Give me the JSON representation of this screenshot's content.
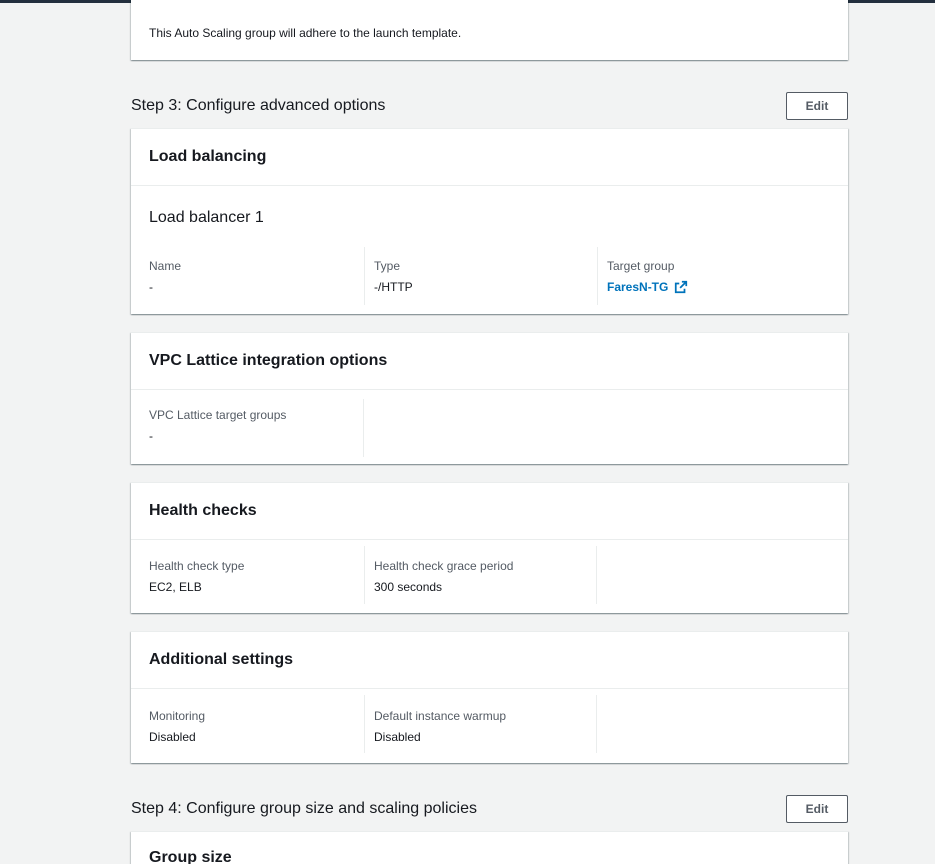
{
  "step2_tail": {
    "text": "This Auto Scaling group will adhere to the launch template."
  },
  "step3": {
    "title": "Step 3: Configure advanced options",
    "edit_label": "Edit"
  },
  "load_balancing": {
    "title": "Load balancing",
    "subtitle": "Load balancer 1",
    "fields": [
      {
        "label": "Name",
        "value": "-"
      },
      {
        "label": "Type",
        "value": "-/HTTP"
      },
      {
        "label": "Target group",
        "value": "FaresN-TG"
      }
    ]
  },
  "vpc_lattice": {
    "title": "VPC Lattice integration options",
    "fields": [
      {
        "label": "VPC Lattice target groups",
        "value": "-"
      }
    ]
  },
  "health_checks": {
    "title": "Health checks",
    "fields": [
      {
        "label": "Health check type",
        "value": "EC2, ELB"
      },
      {
        "label": "Health check grace period",
        "value": "300 seconds"
      }
    ]
  },
  "additional_settings": {
    "title": "Additional settings",
    "fields": [
      {
        "label": "Monitoring",
        "value": "Disabled"
      },
      {
        "label": "Default instance warmup",
        "value": "Disabled"
      }
    ]
  },
  "step4": {
    "title": "Step 4: Configure group size and scaling policies",
    "edit_label": "Edit"
  },
  "group_size": {
    "title": "Group size"
  },
  "colors": {
    "link": "#0073bb",
    "topbar": "#232f3e",
    "background": "#f2f3f3"
  },
  "icons": {
    "external_link": "external-link-icon"
  }
}
